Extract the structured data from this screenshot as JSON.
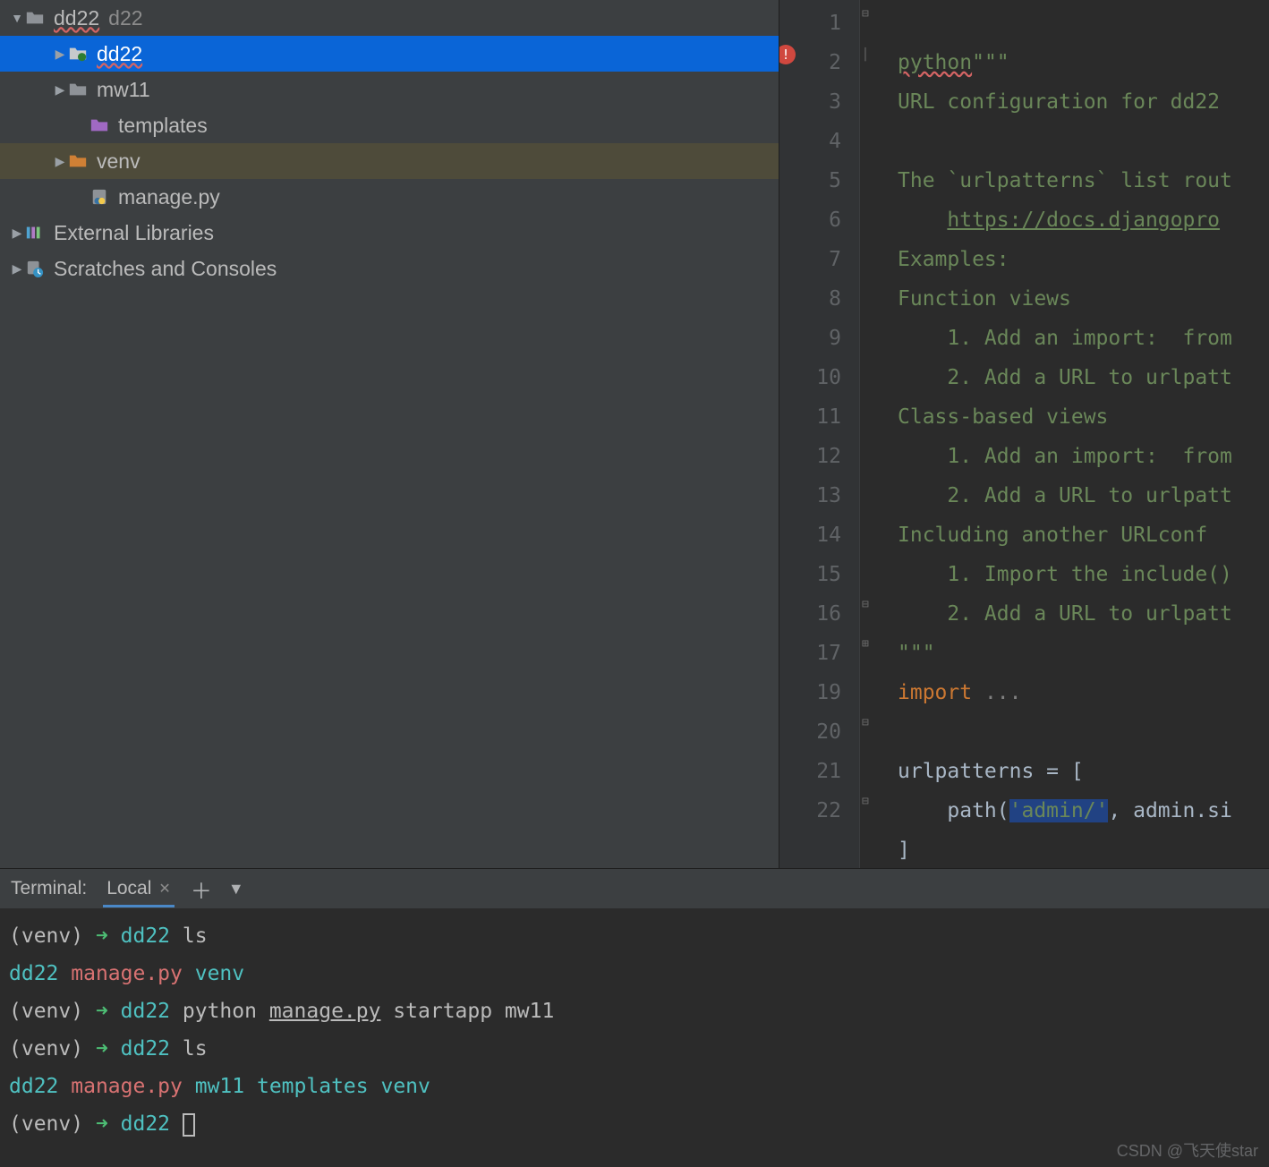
{
  "tree": {
    "root": {
      "name": "dd22",
      "suffix": "d22"
    },
    "items": [
      {
        "name": "dd22",
        "kind": "dir-django-sel",
        "indent": 58,
        "arrow": "right",
        "selected": true,
        "underline": true
      },
      {
        "name": "mw11",
        "kind": "dir",
        "indent": 58,
        "arrow": "right"
      },
      {
        "name": "templates",
        "kind": "dir-purple",
        "indent": 82,
        "arrow": ""
      },
      {
        "name": "venv",
        "kind": "dir-orange",
        "indent": 58,
        "arrow": "right",
        "highlight": true
      },
      {
        "name": "manage.py",
        "kind": "file-py",
        "indent": 82,
        "arrow": ""
      }
    ],
    "external": "External Libraries",
    "scratches": "Scratches and Consoles"
  },
  "editor": {
    "lines": [
      1,
      2,
      3,
      4,
      5,
      6,
      7,
      8,
      9,
      10,
      11,
      12,
      13,
      14,
      15,
      16,
      17,
      19,
      20,
      21,
      22
    ],
    "code": {
      "l1_a": "python",
      "l1_b": "\"\"\"",
      "l2": "URL configuration for dd22 ",
      "l3": "",
      "l4": "The `urlpatterns` list rout",
      "l5": "https://docs.djangopro",
      "l6": "Examples:",
      "l7": "Function views",
      "l8": "    1. Add an import:  from",
      "l9": "    2. Add a URL to urlpatt",
      "l10": "Class-based views",
      "l11": "    1. Add an import:  from",
      "l12": "    2. Add a URL to urlpatt",
      "l13": "Including another URLconf",
      "l14": "    1. Import the include()",
      "l15": "    2. Add a URL to urlpatt",
      "l16": "\"\"\"",
      "l17a": "import ",
      "l17b": "...",
      "l20": "urlpatterns = [",
      "l21a": "    path(",
      "l21b": "'admin/'",
      "l21c": ", admin.si",
      "l22": "]"
    }
  },
  "terminal": {
    "title": "Terminal:",
    "tab": "Local",
    "lines": [
      {
        "t": "prompt",
        "dir": "dd22",
        "cmd": "ls"
      },
      {
        "t": "out",
        "c": [
          [
            "dir",
            "dd22"
          ],
          [
            "pad",
            "      "
          ],
          [
            "red",
            "manage.py"
          ],
          [
            "sp",
            " "
          ],
          [
            "dir",
            "venv"
          ]
        ]
      },
      {
        "t": "prompt",
        "dir": "dd22",
        "cmd": "python ",
        "rest": [
          [
            "uline",
            "manage.py"
          ],
          [
            "sp",
            " startapp mw11"
          ]
        ]
      },
      {
        "t": "prompt",
        "dir": "dd22",
        "cmd": "ls"
      },
      {
        "t": "out",
        "c": [
          [
            "dir",
            "dd22"
          ],
          [
            "pad",
            "      "
          ],
          [
            "red",
            "manage.py"
          ],
          [
            "sp",
            " "
          ],
          [
            "dir",
            "mw11"
          ],
          [
            "pad",
            "      "
          ],
          [
            "dir",
            "templates"
          ],
          [
            "sp",
            " "
          ],
          [
            "dir",
            "venv"
          ]
        ]
      },
      {
        "t": "prompt",
        "dir": "dd22",
        "cmd": "",
        "cursor": true
      }
    ]
  },
  "watermark": "CSDN @飞天使star"
}
